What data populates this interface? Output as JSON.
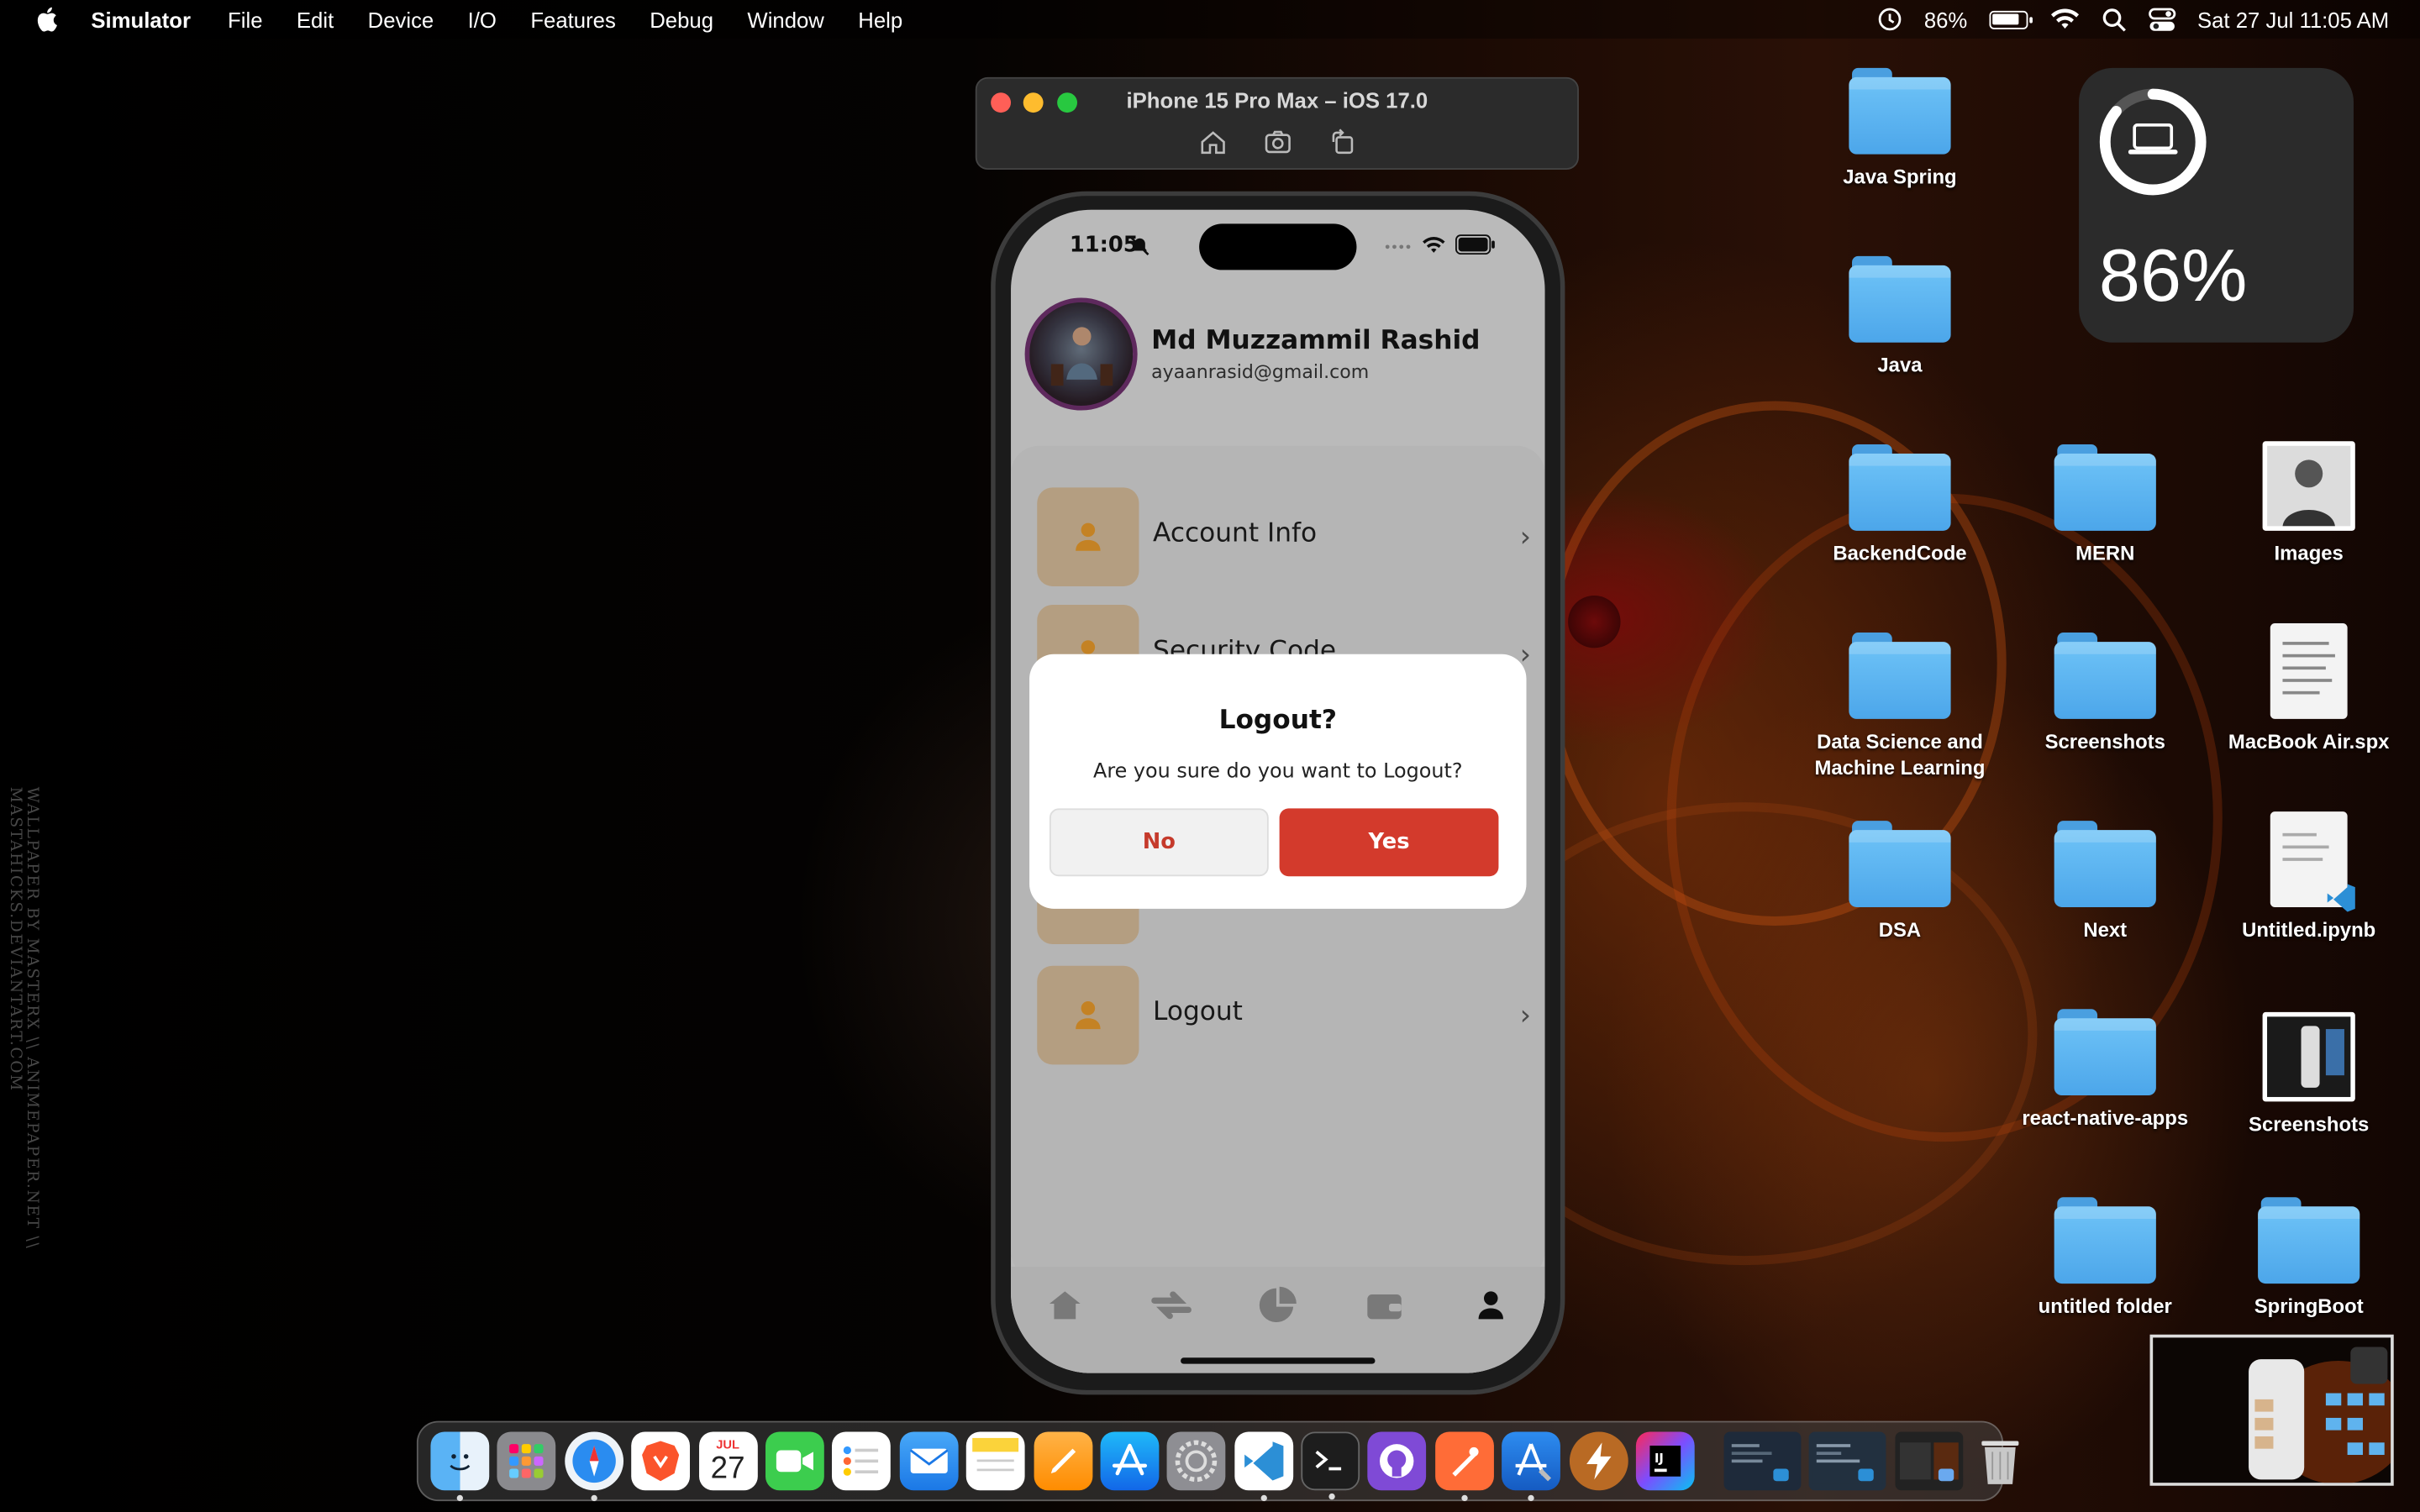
{
  "menubar": {
    "app_name": "Simulator",
    "items": [
      "File",
      "Edit",
      "Device",
      "I/O",
      "Features",
      "Debug",
      "Window",
      "Help"
    ],
    "battery_percent": "86%",
    "battery_level": 0.86,
    "datetime": "Sat 27 Jul  11:05 AM"
  },
  "simulator": {
    "window_title": "iPhone 15 Pro Max – iOS 17.0",
    "tools": [
      "home-icon",
      "screenshot-icon",
      "rotate-icon"
    ]
  },
  "phone": {
    "status_time": "11:05",
    "profile": {
      "name": "Md Muzzammil Rashid",
      "email": "ayaanrasid@gmail.com"
    },
    "menu": [
      {
        "label": "Account Info"
      },
      {
        "label": "Security Code"
      },
      {
        "label": "Logout"
      }
    ],
    "dialog": {
      "title": "Logout?",
      "message": "Are you sure do you want to Logout?",
      "no_label": "No",
      "yes_label": "Yes"
    },
    "tabs": [
      "home-icon",
      "transfer-icon",
      "pie-chart-icon",
      "wallet-icon",
      "profile-icon"
    ],
    "colors": {
      "accent": "#d33a2c",
      "tile": "#cdb493"
    }
  },
  "widget": {
    "battery_percent": "86%",
    "level": 0.86
  },
  "desktop": {
    "icons": [
      {
        "label": "Java Spring",
        "type": "folder"
      },
      {
        "label": "Java",
        "type": "folder"
      },
      {
        "label": "BackendCode",
        "type": "folder"
      },
      {
        "label": "MERN",
        "type": "folder"
      },
      {
        "label": "Images",
        "type": "photo"
      },
      {
        "label": "Data Science and Machine Learning",
        "type": "folder"
      },
      {
        "label": "Screenshots",
        "type": "folder"
      },
      {
        "label": "MacBook Air.spx",
        "type": "document"
      },
      {
        "label": "DSA",
        "type": "folder"
      },
      {
        "label": "Next",
        "type": "folder"
      },
      {
        "label": "Untitled.ipynb",
        "type": "document"
      },
      {
        "label": "react-native-apps",
        "type": "folder"
      },
      {
        "label": "Screenshots",
        "type": "photo"
      },
      {
        "label": "untitled folder",
        "type": "folder"
      },
      {
        "label": "SpringBoot",
        "type": "folder"
      }
    ]
  },
  "wallpaper_watermark": "WALLPAPER BY MASTERX \\\\ ANIMEPAPER.NET \\\\ MASTAHICKS.DEVIANTART.COM",
  "dock": {
    "calendar_month": "JUL",
    "calendar_day": "27",
    "apps": [
      "finder-icon",
      "launchpad-icon",
      "safari-icon",
      "brave-icon",
      "calendar-icon",
      "facetime-icon",
      "reminders-icon",
      "mail-icon",
      "notes-icon",
      "pages-icon",
      "app-store-icon",
      "system-settings-icon",
      "vscode-icon",
      "terminal-icon",
      "github-desktop-icon",
      "postman-icon",
      "xcode-icon",
      "reeder-icon",
      "intellij-icon"
    ]
  }
}
